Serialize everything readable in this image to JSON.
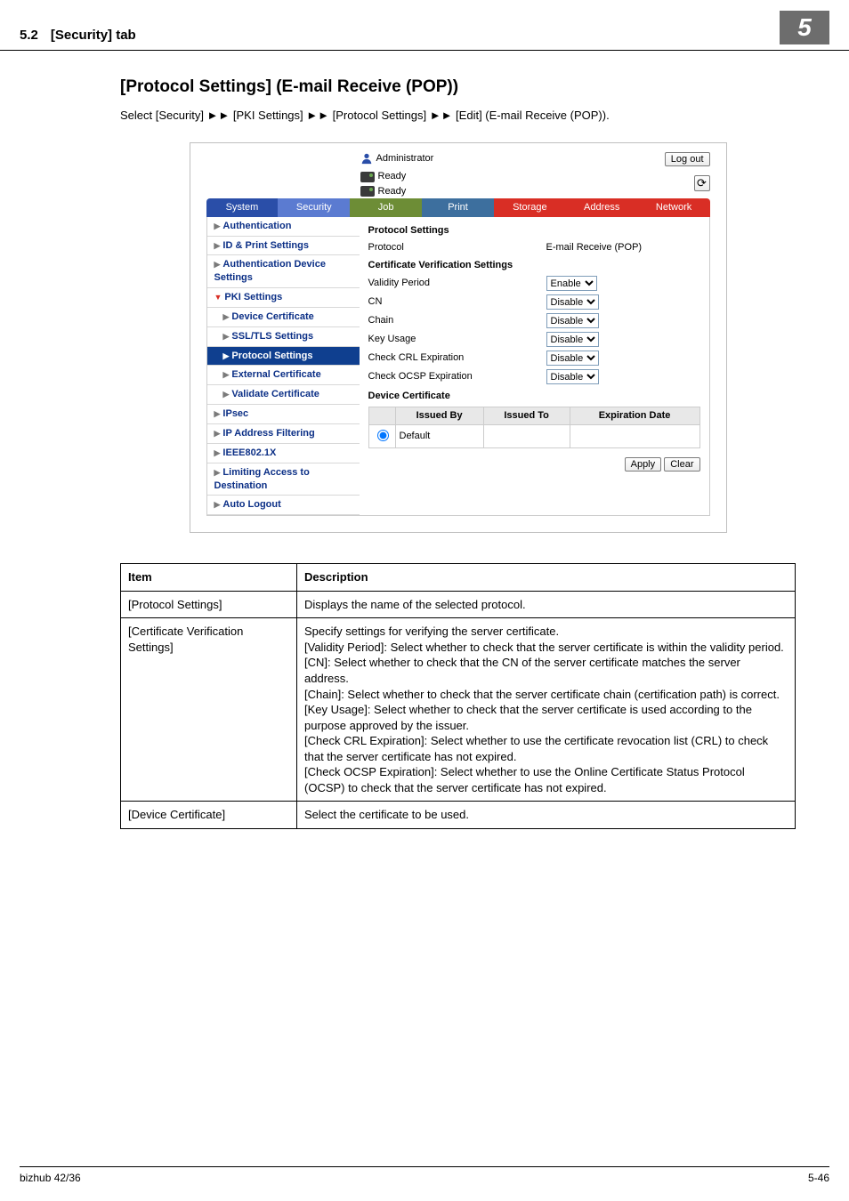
{
  "header": {
    "section_num": "5.2",
    "tab_title": "[Security] tab",
    "chapter_num": "5"
  },
  "page": {
    "title": "[Protocol Settings] (E-mail Receive (POP))",
    "lead": "Select [Security] ►► [PKI Settings] ►► [Protocol Settings] ►► [Edit] (E-mail Receive (POP))."
  },
  "shot": {
    "administrator": "Administrator",
    "logout": "Log out",
    "ready1": "Ready",
    "ready2": "Ready",
    "tabs": {
      "system": "System",
      "security": "Security",
      "job": "Job",
      "print": "Print",
      "storage": "Storage",
      "address": "Address",
      "network": "Network"
    },
    "sidebar": {
      "auth": "Authentication",
      "idprint": "ID & Print Settings",
      "authdev": "Authentication Device Settings",
      "pki": "PKI Settings",
      "devcert": "Device Certificate",
      "ssltls": "SSL/TLS Settings",
      "protoset": "Protocol Settings",
      "extcert": "External Certificate",
      "validate": "Validate Certificate",
      "ipsec": "IPsec",
      "ipfilter": "IP Address Filtering",
      "ieee": "IEEE802.1X",
      "limiting": "Limiting Access to Destination",
      "autolog": "Auto Logout"
    },
    "main": {
      "protoset_head": "Protocol Settings",
      "protocol_lbl": "Protocol",
      "protocol_val": "E-mail Receive (POP)",
      "certver_head": "Certificate Verification Settings",
      "validity_lbl": "Validity Period",
      "cn_lbl": "CN",
      "chain_lbl": "Chain",
      "keyusage_lbl": "Key Usage",
      "crl_lbl": "Check CRL Expiration",
      "ocsp_lbl": "Check OCSP Expiration",
      "enable_opt": "Enable",
      "disable_opt": "Disable",
      "devcert_head": "Device Certificate",
      "tbl_by": "Issued By",
      "tbl_to": "Issued To",
      "tbl_exp": "Expiration Date",
      "default_row": "Default",
      "apply": "Apply",
      "clear": "Clear"
    }
  },
  "table": {
    "head_item": "Item",
    "head_desc": "Description",
    "r1_item": "[Protocol Settings]",
    "r1_desc": "Displays the name of the selected protocol.",
    "r2_item": "[Certificate Verification Settings]",
    "r2_desc": "Specify settings for verifying the server certificate.\n[Validity Period]: Select whether to check that the server certificate is within the validity period.\n[CN]: Select whether to check that the CN of the server certificate matches the server address.\n[Chain]: Select whether to check that the server certificate chain (certification path) is correct.\n[Key Usage]: Select whether to check that the server certificate is used according to the purpose approved by the issuer.\n[Check CRL Expiration]: Select whether to use the certificate revocation list (CRL) to check that the server certificate has not expired.\n[Check OCSP Expiration]: Select whether to use the Online Certificate Status Protocol (OCSP) to check that the server certificate has not expired.",
    "r3_item": "[Device Certificate]",
    "r3_desc": "Select the certificate to be used."
  },
  "footer": {
    "left": "bizhub 42/36",
    "right": "5-46"
  }
}
